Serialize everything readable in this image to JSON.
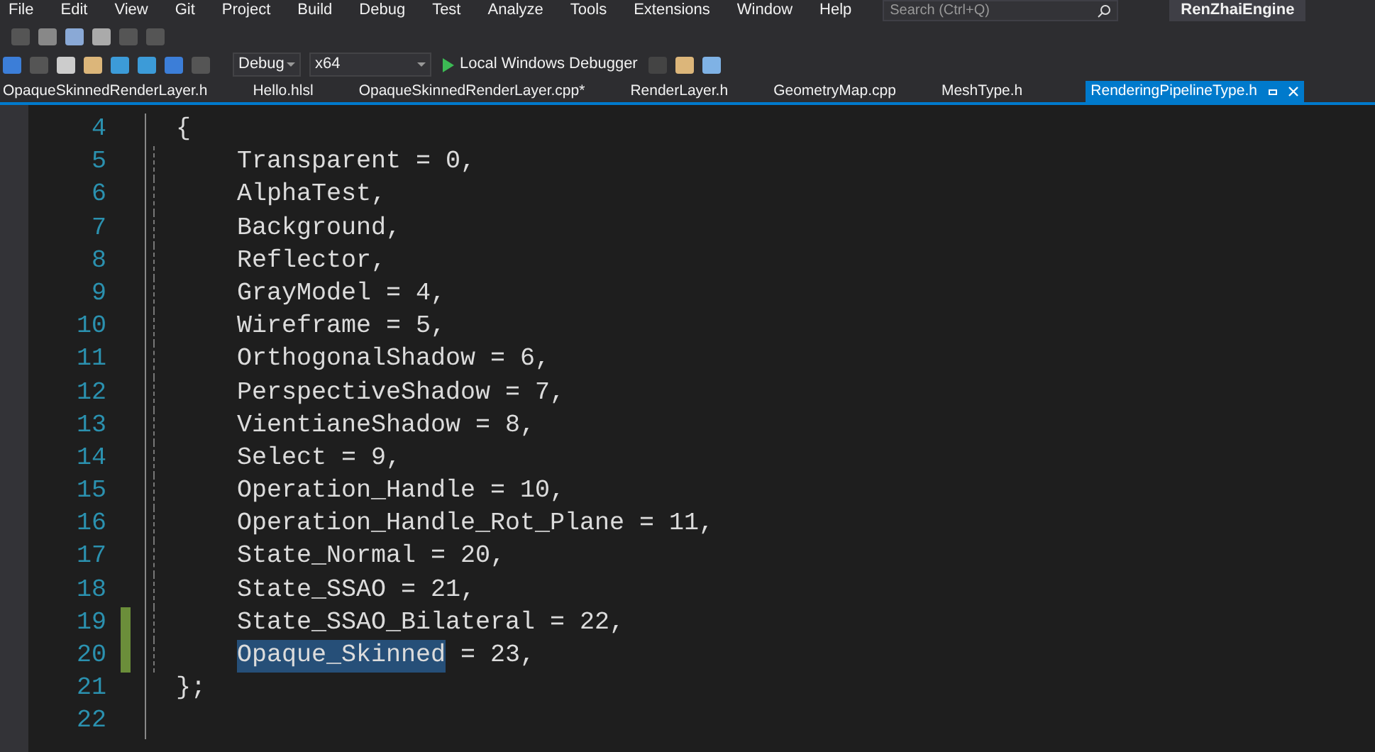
{
  "menu": {
    "items": [
      "File",
      "Edit",
      "View",
      "Git",
      "Project",
      "Build",
      "Debug",
      "Test",
      "Analyze",
      "Tools",
      "Extensions",
      "Window",
      "Help"
    ],
    "search": {
      "placeholder": "Search (Ctrl+Q)"
    },
    "solution": "RenZhaiEngine"
  },
  "toolbar": {
    "configuration": "Debug",
    "platform": "x64",
    "run": "Local Windows Debugger"
  },
  "tabs": [
    {
      "label": "OpaqueSkinnedRenderLayer.h",
      "selected": false
    },
    {
      "label": "Hello.hlsl",
      "selected": false
    },
    {
      "label": "OpaqueSkinnedRenderLayer.cpp*",
      "selected": false
    },
    {
      "label": "RenderLayer.h",
      "selected": false
    },
    {
      "label": "GeometryMap.cpp",
      "selected": false
    },
    {
      "label": "MeshType.h",
      "selected": false
    },
    {
      "label": "RenderingPipelineType.h",
      "selected": true
    }
  ],
  "lines": [
    {
      "number": "4",
      "indent": false,
      "changed": false,
      "parts": [
        {
          "text": "{",
          "selected": false
        }
      ]
    },
    {
      "number": "5",
      "indent": true,
      "changed": false,
      "parts": [
        {
          "text": "Transparent = 0,",
          "selected": false
        }
      ]
    },
    {
      "number": "6",
      "indent": true,
      "changed": false,
      "parts": [
        {
          "text": "AlphaTest,",
          "selected": false
        }
      ]
    },
    {
      "number": "7",
      "indent": true,
      "changed": false,
      "parts": [
        {
          "text": "Background,",
          "selected": false
        }
      ]
    },
    {
      "number": "8",
      "indent": true,
      "changed": false,
      "parts": [
        {
          "text": "Reflector,",
          "selected": false
        }
      ]
    },
    {
      "number": "9",
      "indent": true,
      "changed": false,
      "parts": [
        {
          "text": "GrayModel = 4,",
          "selected": false
        }
      ]
    },
    {
      "number": "10",
      "indent": true,
      "changed": false,
      "parts": [
        {
          "text": "Wireframe = 5,",
          "selected": false
        }
      ]
    },
    {
      "number": "11",
      "indent": true,
      "changed": false,
      "parts": [
        {
          "text": "OrthogonalShadow = 6,",
          "selected": false
        }
      ]
    },
    {
      "number": "12",
      "indent": true,
      "changed": false,
      "parts": [
        {
          "text": "PerspectiveShadow = 7,",
          "selected": false
        }
      ]
    },
    {
      "number": "13",
      "indent": true,
      "changed": false,
      "parts": [
        {
          "text": "VientianeShadow = 8,",
          "selected": false
        }
      ]
    },
    {
      "number": "14",
      "indent": true,
      "changed": false,
      "parts": [
        {
          "text": "Select = 9,",
          "selected": false
        }
      ]
    },
    {
      "number": "15",
      "indent": true,
      "changed": false,
      "parts": [
        {
          "text": "Operation_Handle = 10,",
          "selected": false
        }
      ]
    },
    {
      "number": "16",
      "indent": true,
      "changed": false,
      "parts": [
        {
          "text": "Operation_Handle_Rot_Plane = 11,",
          "selected": false
        }
      ]
    },
    {
      "number": "17",
      "indent": true,
      "changed": false,
      "parts": [
        {
          "text": "State_Normal = 20,",
          "selected": false
        }
      ]
    },
    {
      "number": "18",
      "indent": true,
      "changed": false,
      "parts": [
        {
          "text": "State_SSAO = 21,",
          "selected": false
        }
      ]
    },
    {
      "number": "19",
      "indent": true,
      "changed": true,
      "parts": [
        {
          "text": "State_SSAO_Bilateral = 22,",
          "selected": false
        }
      ]
    },
    {
      "number": "20",
      "indent": true,
      "changed": true,
      "parts": [
        {
          "text": "Opaque_Skinned",
          "selected": true
        },
        {
          "text": " = 23,",
          "selected": false
        }
      ]
    },
    {
      "number": "21",
      "indent": false,
      "changed": false,
      "parts": [
        {
          "text": "};",
          "selected": false
        }
      ]
    },
    {
      "number": "22",
      "indent": false,
      "changed": false
    }
  ]
}
